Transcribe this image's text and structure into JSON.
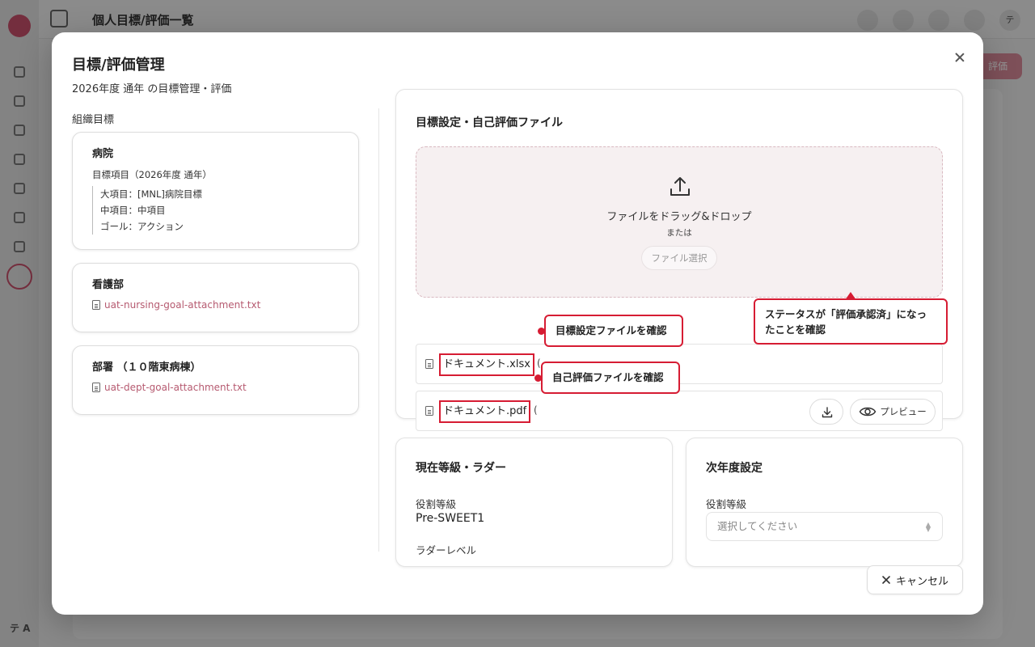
{
  "background": {
    "page_title": "個人目標/評価一覧",
    "avatar_initials": "テ A",
    "header_avatar": "テ",
    "action_button": "評価"
  },
  "modal": {
    "title": "目標/評価管理",
    "subtitle": "2026年度 通年 の目標管理・評価",
    "close_icon": "close-icon"
  },
  "org_goals": {
    "section_label": "組織目標",
    "cards": [
      {
        "title": "病院",
        "goal_heading": "目標項目（2026年度 通年）",
        "lines": [
          "大項目：[MNL]病院目標",
          "中項目：中項目",
          "ゴール：アクション"
        ]
      },
      {
        "title": "看護部",
        "attachment": "uat-nursing-goal-attachment.txt"
      },
      {
        "title": "部署 （１０階東病棟）",
        "attachment": "uat-dept-goal-attachment.txt"
      }
    ]
  },
  "upload": {
    "title": "目標設定・自己評価ファイル",
    "drop_text": "ファイルをドラッグ&ドロップ",
    "or_text": "または",
    "select_button": "ファイル選択",
    "files": [
      {
        "name": "ドキュメント.xlsx",
        "paren": "("
      },
      {
        "name": "ドキュメント.pdf",
        "paren": "(",
        "preview_label": "プレビュー"
      }
    ]
  },
  "annotations": {
    "goal_file": "目標設定ファイルを確認",
    "self_eval_file": "自己評価ファイルを確認",
    "status": "ステータスが「評価承認済」になったことを確認"
  },
  "current_grade": {
    "title": "現在等級・ラダー",
    "role_label": "役割等級",
    "role_value": "Pre-SWEET1",
    "ladder_label": "ラダーレベル"
  },
  "next_year": {
    "title": "次年度設定",
    "role_label": "役割等級",
    "select_placeholder": "選択してください"
  },
  "footer": {
    "cancel_label": "キャンセル"
  },
  "colors": {
    "accent": "#c9506b",
    "link": "#b65a70",
    "annotation": "#d61c33",
    "dropzone_bg": "#f6f0f1"
  }
}
